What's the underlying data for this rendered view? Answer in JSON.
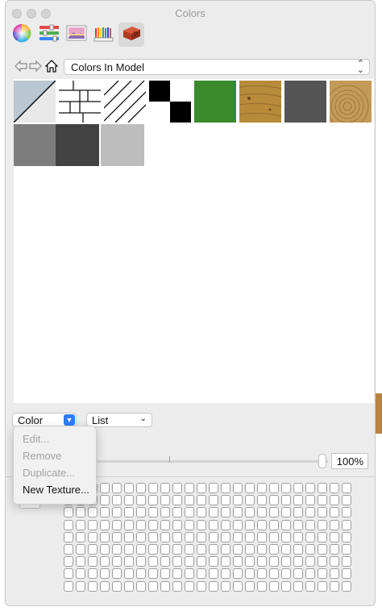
{
  "window": {
    "title": "Colors"
  },
  "toolbar": {
    "tabs": [
      {
        "name": "color-wheel-icon",
        "label": "Color Wheel"
      },
      {
        "name": "color-sliders-icon",
        "label": "Color Sliders"
      },
      {
        "name": "image-palettes-icon",
        "label": "Image Palettes"
      },
      {
        "name": "crayons-icon",
        "label": "Crayons"
      },
      {
        "name": "brick-texture-icon",
        "label": "Materials",
        "active": true
      }
    ]
  },
  "nav": {
    "library_select": "Colors In Model",
    "back_icon": "back-arrow-icon",
    "forward_icon": "forward-arrow-icon",
    "home_icon": "home-icon"
  },
  "swatches": [
    {
      "name": "swatch-blue-gray-diagonal",
      "color": "#b8c7d1"
    },
    {
      "name": "swatch-bricks-outline",
      "color": "#ffffff"
    },
    {
      "name": "swatch-diagonal-lines",
      "color": "#ffffff"
    },
    {
      "name": "swatch-checker",
      "color": "#000000"
    },
    {
      "name": "swatch-green",
      "color": "#3a8a2c"
    },
    {
      "name": "swatch-wood-light",
      "color": "#b88a3a"
    },
    {
      "name": "swatch-dark-gray",
      "color": "#555555"
    },
    {
      "name": "swatch-wood-rings",
      "color": "#c49a58"
    },
    {
      "name": "swatch-medium-gray",
      "color": "#7d7d7d"
    },
    {
      "name": "swatch-charcoal",
      "color": "#424242"
    },
    {
      "name": "swatch-light-gray",
      "color": "#bdbdbd"
    }
  ],
  "controls": {
    "color_button": "Color",
    "view_select": "List",
    "percent": "100%",
    "slider_level": 0.96
  },
  "menu": {
    "items": [
      {
        "label": "Edit...",
        "enabled": false
      },
      {
        "label": "Remove",
        "enabled": false
      },
      {
        "label": "Duplicate...",
        "enabled": false
      },
      {
        "label": "New Texture...",
        "enabled": true
      }
    ]
  },
  "colors": {
    "accent": "#2f7cf6",
    "window_bg": "#ececec",
    "panel_bg": "#ffffff"
  }
}
